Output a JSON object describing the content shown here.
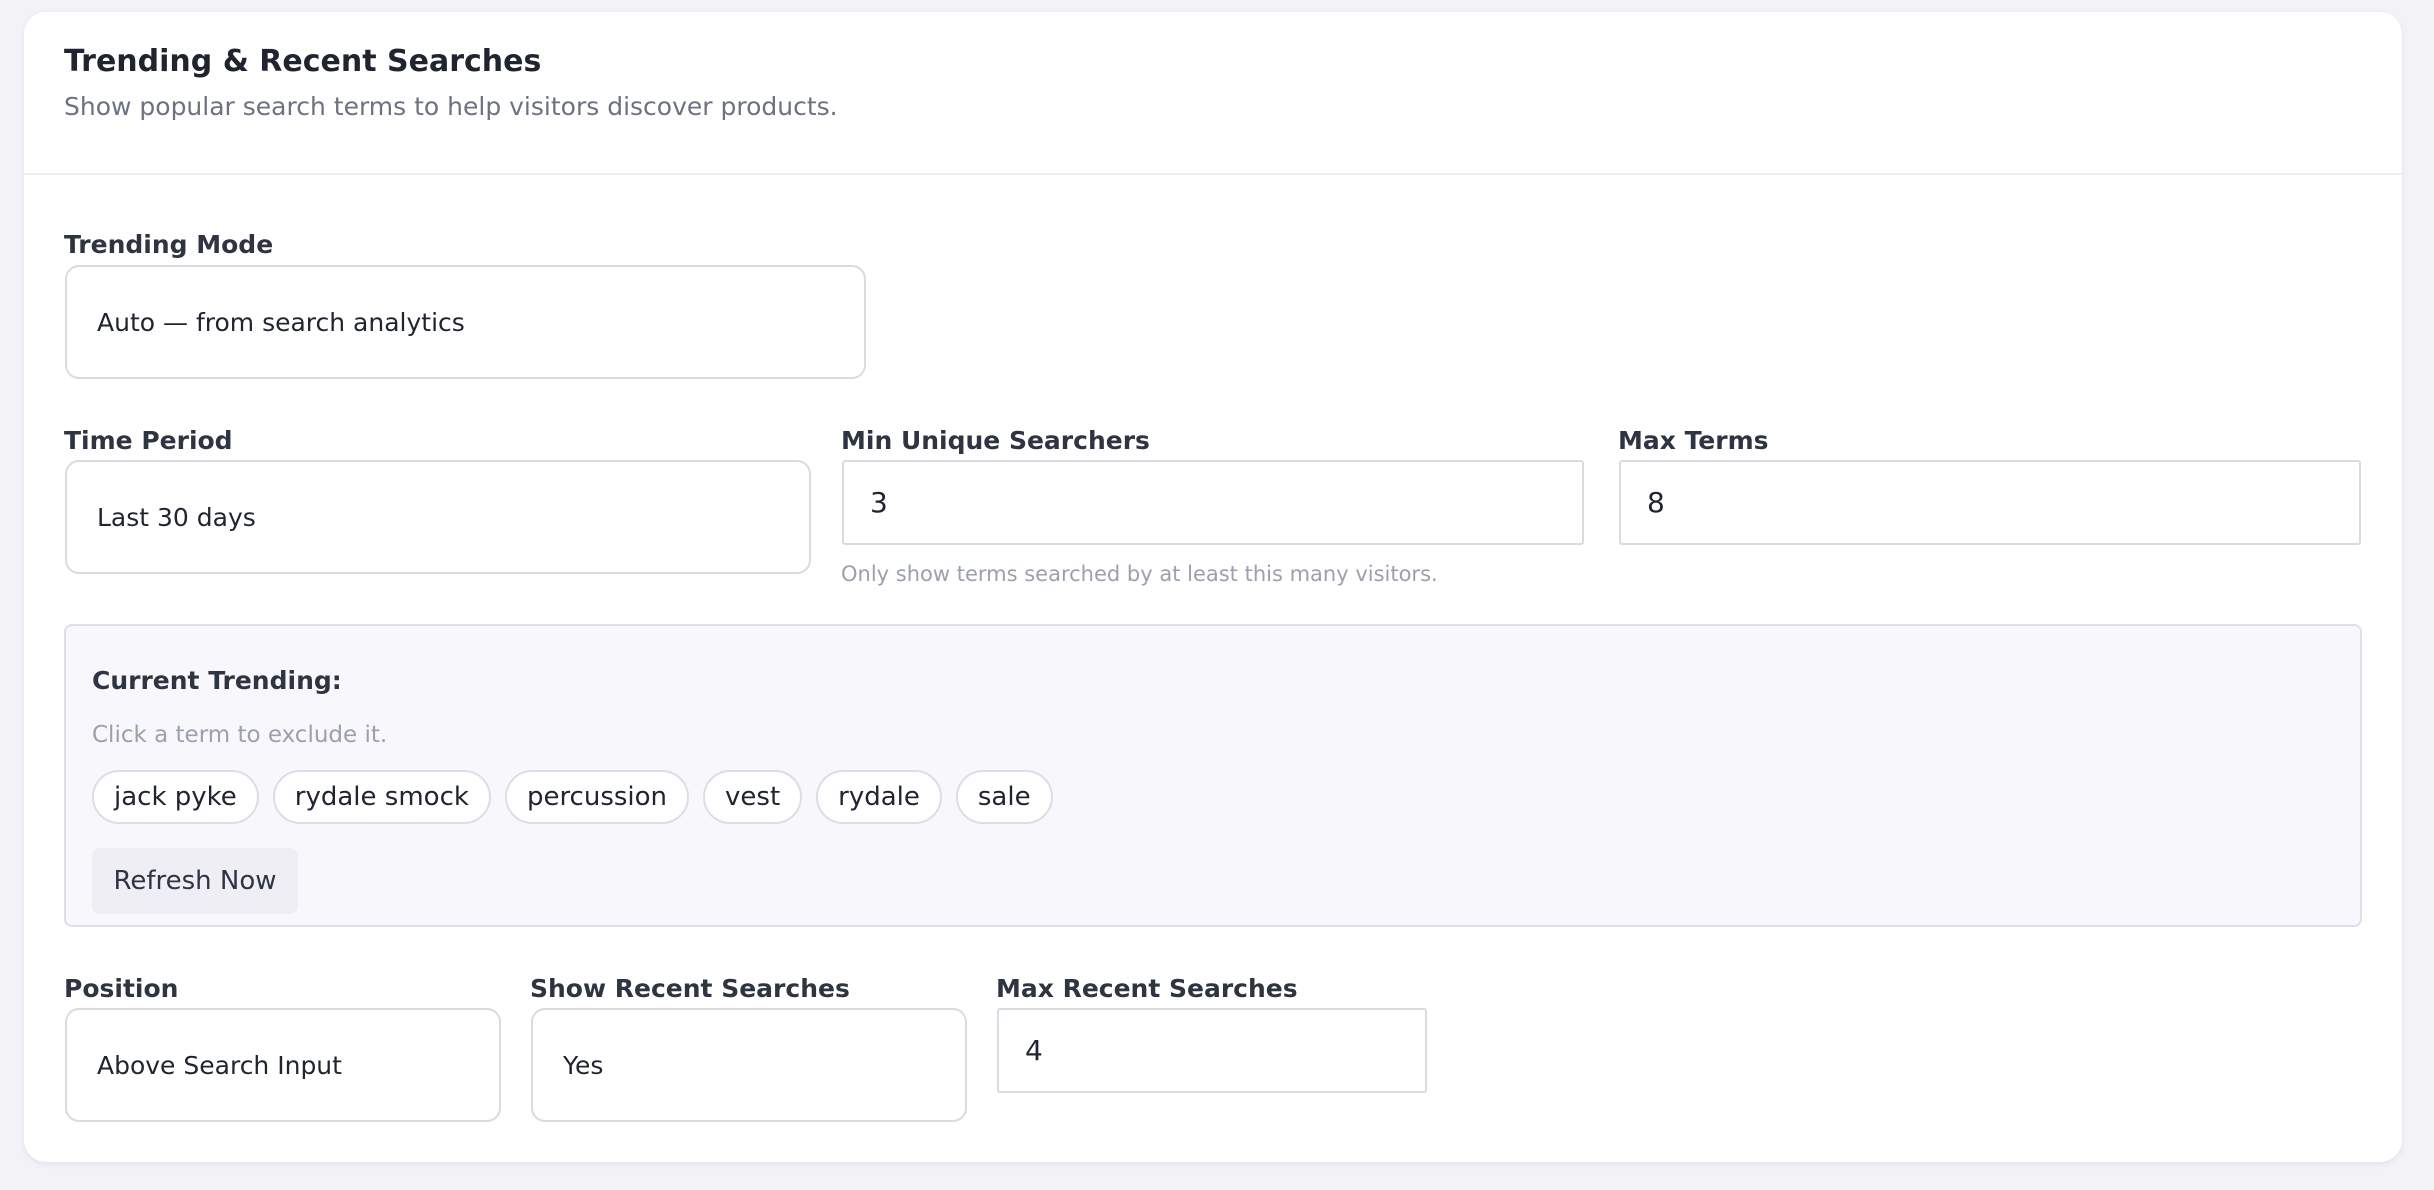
{
  "section": {
    "title": "Trending & Recent Searches",
    "subtitle": "Show popular search terms to help visitors discover products."
  },
  "trending_mode": {
    "label": "Trending Mode",
    "value": "Auto — from search analytics"
  },
  "time_period": {
    "label": "Time Period",
    "value": "Last 30 days"
  },
  "min_unique_searchers": {
    "label": "Min Unique Searchers",
    "value": "3",
    "hint": "Only show terms searched by at least this many visitors."
  },
  "max_terms": {
    "label": "Max Terms",
    "value": "8"
  },
  "current_trending": {
    "title": "Current Trending:",
    "hint": "Click a term to exclude it.",
    "terms": [
      "jack pyke",
      "rydale smock",
      "percussion",
      "vest",
      "rydale",
      "sale"
    ],
    "refresh_label": "Refresh Now"
  },
  "position": {
    "label": "Position",
    "value": "Above Search Input"
  },
  "show_recent_searches": {
    "label": "Show Recent Searches",
    "value": "Yes"
  },
  "max_recent_searches": {
    "label": "Max Recent Searches",
    "value": "4"
  }
}
